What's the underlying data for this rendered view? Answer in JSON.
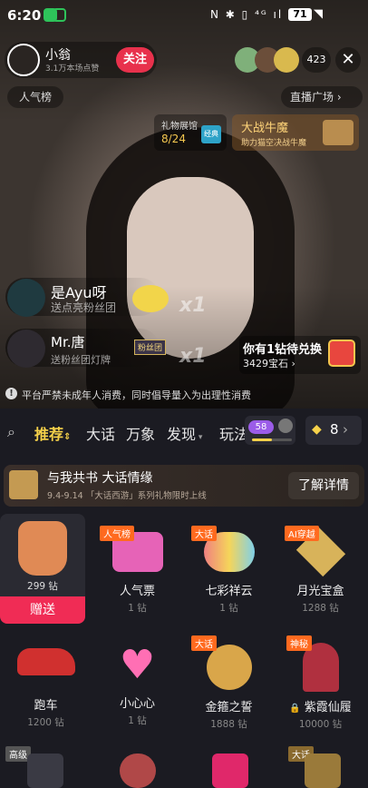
{
  "status": {
    "time": "6:20",
    "battery": "71"
  },
  "anchor": {
    "name": "小翁",
    "fans": "3.1万本场点赞",
    "follow": "关注"
  },
  "viewer_count": "423",
  "popularity": "人气榜",
  "live_square": "直播广场",
  "gift_gallery": {
    "title": "礼物展馆",
    "progress": "8/24",
    "tag": "经典"
  },
  "battle": {
    "title": "大战牛魔",
    "sub": "助力猫空决战牛魔"
  },
  "messages": [
    {
      "user": "是Ayu呀",
      "text": "送点亮粉丝团",
      "multiplier": "x1"
    },
    {
      "user": "Mr.唐",
      "text": "送粉丝团灯牌",
      "badge": "粉丝团",
      "multiplier": "x1"
    }
  ],
  "exchange": {
    "title": "你有1钻待兑换",
    "gems": "3429宝石"
  },
  "notice": "平台严禁未成年人消费，同时倡导量入为出理性消费",
  "tabs": {
    "items": [
      "推荐",
      "大话",
      "万象",
      "发现",
      "玩法"
    ],
    "level": "58",
    "gems": "8"
  },
  "banner": {
    "title": "与我共书 大话情缘",
    "sub": "9.4-9.14 「大话西游」系列礼物限时上线",
    "button": "了解详情"
  },
  "gifts": [
    {
      "name": "",
      "price": "299 钻",
      "send": "赠送",
      "tag": ""
    },
    {
      "name": "人气票",
      "price": "1 钻",
      "tag": "人气榜"
    },
    {
      "name": "七彩祥云",
      "price": "1 钻",
      "tag": "大话"
    },
    {
      "name": "月光宝盒",
      "price": "1288 钻",
      "tag": "AI穿越"
    },
    {
      "name": "跑车",
      "price": "1200 钻",
      "tag": ""
    },
    {
      "name": "小心心",
      "price": "1 钻",
      "tag": ""
    },
    {
      "name": "金箍之誓",
      "price": "1888 钻",
      "tag": "大话"
    },
    {
      "name": "紫霞仙履",
      "price": "10000 钻",
      "tag": "神秘"
    }
  ],
  "bottom_tags": {
    "left": "高级",
    "right": "大话"
  }
}
